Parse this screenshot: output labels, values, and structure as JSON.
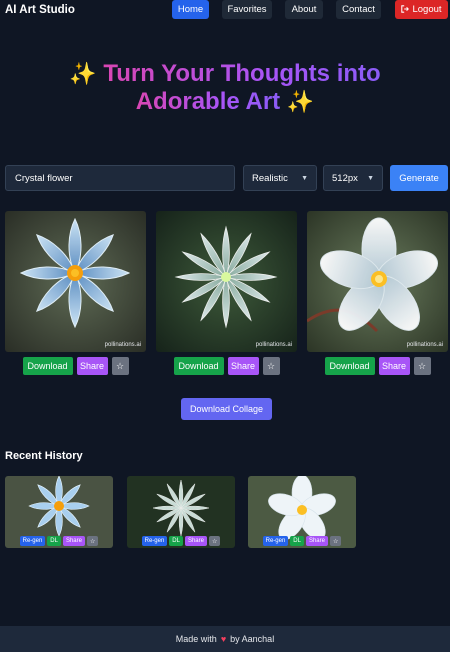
{
  "nav": {
    "brand": "AI Art Studio",
    "items": [
      {
        "label": "Home",
        "active": true
      },
      {
        "label": "Favorites"
      },
      {
        "label": "About"
      },
      {
        "label": "Contact"
      }
    ],
    "logout_label": "Logout",
    "logout_icon": "logout-icon"
  },
  "hero": {
    "spark": "✨",
    "line1": "Turn Your Thoughts into",
    "line2": "Adorable Art"
  },
  "controls": {
    "prompt_value": "Crystal flower",
    "style_value": "Realistic",
    "size_value": "512px",
    "generate_label": "Generate"
  },
  "gallery": [
    {
      "watermark": "pollinations.ai",
      "download": "Download",
      "share": "Share",
      "fav": "☆"
    },
    {
      "watermark": "pollinations.ai",
      "download": "Download",
      "share": "Share",
      "fav": "☆"
    },
    {
      "watermark": "pollinations.ai",
      "download": "Download",
      "share": "Share",
      "fav": "☆"
    }
  ],
  "collage_label": "Download Collage",
  "history": {
    "title": "Recent History",
    "items": [
      {
        "regen": "Re-gen",
        "dl": "DL",
        "share": "Share",
        "star": "☆"
      },
      {
        "regen": "Re-gen",
        "dl": "DL",
        "share": "Share",
        "star": "☆"
      },
      {
        "regen": "Re-gen",
        "dl": "DL",
        "share": "Share",
        "star": "☆"
      }
    ]
  },
  "footer": {
    "before": "Made with",
    "after": "by Aanchal"
  },
  "colors": {
    "background": "#0f1624",
    "primary": "#2563eb",
    "danger": "#dc2626",
    "success": "#16a34a",
    "share": "#a855f7",
    "collage": "#6366f1"
  }
}
